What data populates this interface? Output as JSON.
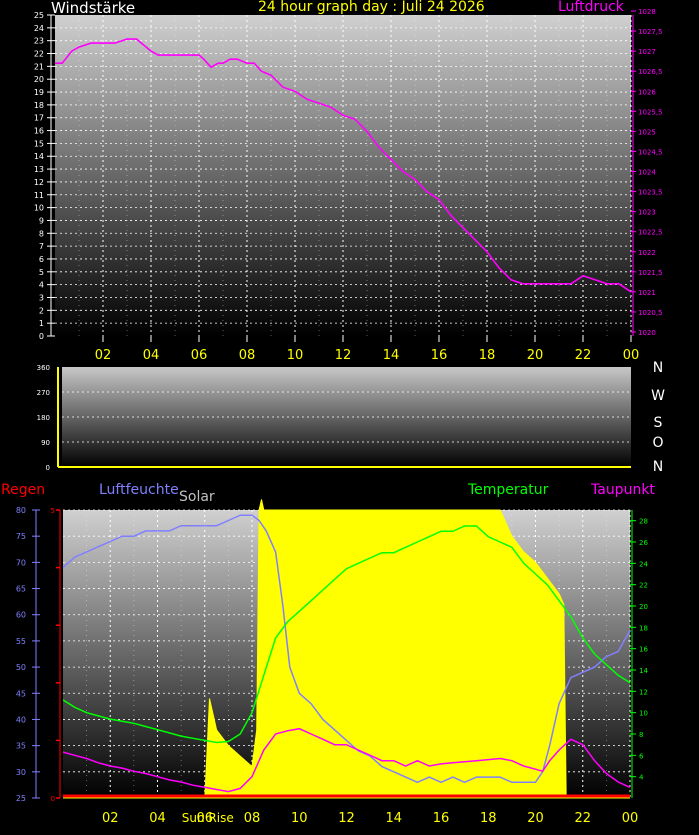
{
  "title": "24 hour graph day : Juli 24 2026",
  "colors": {
    "background": "#000000",
    "wind_label": "#ffffff",
    "pressure": "#ff00ff",
    "humidity": "#8080ff",
    "solar_label": "#c0c0c0",
    "solar_fill": "#ffff00",
    "temperature": "#00ff00",
    "dewpoint": "#ff00ff",
    "rain": "#ff0000",
    "tick_hours": "#ffff00",
    "direction_axis": "#ffff00"
  },
  "chart_data": [
    {
      "type": "line",
      "title": "24 hour graph day : Juli 24 2026",
      "left_axis_label": "Windstärke",
      "right_axis_label": "Luftdruck",
      "left_ylim": [
        0,
        25
      ],
      "left_ticks": [
        "0",
        "1",
        "2",
        "3",
        "4",
        "5",
        "6",
        "7",
        "8",
        "9",
        "10",
        "11",
        "12",
        "13",
        "14",
        "15",
        "16",
        "17",
        "18",
        "19",
        "20",
        "21",
        "22",
        "23",
        "24",
        "25"
      ],
      "right_ylim": [
        1020,
        1028
      ],
      "right_ticks": [
        "1020",
        "1020,5",
        "1021",
        "1021,5",
        "1022",
        "1022,5",
        "1023",
        "1023,5",
        "1024",
        "1024,5",
        "1025",
        "1025,5",
        "1026",
        "1026,5",
        "1027",
        "1027,5",
        "1028"
      ],
      "x_ticks": [
        "02",
        "04",
        "06",
        "08",
        "10",
        "12",
        "14",
        "16",
        "18",
        "20",
        "22",
        "00"
      ],
      "grid": true,
      "series": [
        {
          "name": "Luftdruck",
          "color": "#ff00ff",
          "axis": "right",
          "x": [
            0,
            0.3,
            0.7,
            1.0,
            1.5,
            2.0,
            2.5,
            3.0,
            3.4,
            3.8,
            4.0,
            4.3,
            4.5,
            4.8,
            5.2,
            5.6,
            6.0,
            6.2,
            6.5,
            6.8,
            7.0,
            7.3,
            7.6,
            8.0,
            8.3,
            8.6,
            9.0,
            9.5,
            10.0,
            10.5,
            11.0,
            11.5,
            12.0,
            12.5,
            13.0,
            13.5,
            14.0,
            14.5,
            15.0,
            15.5,
            16.0,
            16.5,
            17.0,
            17.5,
            18.0,
            18.5,
            19.0,
            19.5,
            20.0,
            20.5,
            21.0,
            21.5,
            22.0,
            22.5,
            23.0,
            23.5,
            24.0
          ],
          "y": [
            1026.7,
            1026.7,
            1027.0,
            1027.1,
            1027.2,
            1027.2,
            1027.2,
            1027.3,
            1027.3,
            1027.1,
            1027.0,
            1026.9,
            1026.9,
            1026.9,
            1026.9,
            1026.9,
            1026.9,
            1026.8,
            1026.6,
            1026.7,
            1026.7,
            1026.8,
            1026.8,
            1026.7,
            1026.7,
            1026.5,
            1026.4,
            1026.1,
            1026.0,
            1025.8,
            1025.7,
            1025.6,
            1025.4,
            1025.3,
            1025.0,
            1024.6,
            1024.3,
            1024.0,
            1023.8,
            1023.5,
            1023.3,
            1022.9,
            1022.6,
            1022.3,
            1022.0,
            1021.6,
            1021.3,
            1021.2,
            1021.2,
            1021.2,
            1021.2,
            1021.2,
            1021.4,
            1021.3,
            1021.2,
            1021.2,
            1021.0
          ]
        }
      ]
    },
    {
      "type": "scatter",
      "title": "",
      "ylim": [
        0,
        360
      ],
      "y_ticks": [
        "0",
        "90",
        "180",
        "270",
        "360"
      ],
      "direction_labels": [
        "N",
        "W",
        "S",
        "O",
        "N"
      ],
      "grid": true,
      "series": []
    },
    {
      "type": "area",
      "title": "",
      "legend": [
        "Regen",
        "Luftfeuchte",
        "Solar",
        "Temperatur",
        "Taupunkt"
      ],
      "left_ylim": [
        25,
        80
      ],
      "left_ticks": [
        "25",
        "30",
        "35",
        "40",
        "45",
        "50",
        "55",
        "60",
        "65",
        "70",
        "75",
        "80"
      ],
      "rain_ticks": [
        "0",
        "5"
      ],
      "right_ylim": [
        2,
        29
      ],
      "right_ticks": [
        "4",
        "6",
        "8",
        "10",
        "12",
        "14",
        "16",
        "18",
        "20",
        "22",
        "24",
        "26",
        "28"
      ],
      "x_ticks": [
        "02",
        "04",
        "06",
        "08",
        "10",
        "12",
        "14",
        "16",
        "18",
        "20",
        "22",
        "00"
      ],
      "annotations": [
        "Sun Rise"
      ],
      "sunrise_hour": 6.0,
      "grid": true,
      "series": [
        {
          "name": "Solar",
          "color": "#ffff00",
          "axis": "left",
          "x": [
            0,
            5.9,
            6.0,
            6.2,
            6.5,
            7.0,
            7.5,
            8.0,
            8.2,
            8.3,
            8.4,
            8.5,
            8.6,
            8.8,
            9.0,
            9.5,
            10,
            11,
            12,
            13,
            14,
            15,
            16,
            17,
            18,
            18.5,
            19,
            19.5,
            20,
            20.5,
            21,
            21.2,
            21.3,
            24
          ],
          "y": [
            25,
            25,
            25,
            44,
            38,
            35,
            33,
            31,
            38,
            80,
            82,
            80,
            80,
            80,
            80,
            80,
            80,
            80,
            80,
            80,
            80,
            80,
            80,
            80,
            80,
            80,
            75,
            72,
            70,
            67,
            64,
            62,
            25,
            25
          ]
        },
        {
          "name": "Luftfeuchte",
          "color": "#8080ff",
          "axis": "left",
          "x": [
            0,
            0.5,
            1,
            1.5,
            2,
            2.5,
            3,
            3.5,
            4,
            4.5,
            5,
            5.5,
            6,
            6.5,
            7,
            7.5,
            8,
            8.3,
            8.6,
            9,
            9.3,
            9.6,
            10,
            10.5,
            11,
            11.5,
            12,
            12.5,
            13,
            13.5,
            14,
            14.5,
            15,
            15.5,
            16,
            16.5,
            17,
            17.5,
            18,
            18.5,
            19,
            19.5,
            20,
            20.3,
            20.6,
            21,
            21.5,
            22,
            22.5,
            23,
            23.5,
            24
          ],
          "y": [
            69,
            71,
            72,
            73,
            74,
            75,
            75,
            76,
            76,
            76,
            77,
            77,
            77,
            77,
            78,
            79,
            79,
            78,
            76,
            72,
            62,
            50,
            45,
            43,
            40,
            38,
            36,
            34,
            33,
            31,
            30,
            29,
            28,
            29,
            28,
            29,
            28,
            29,
            29,
            29,
            28,
            28,
            28,
            30,
            35,
            43,
            48,
            49,
            50,
            52,
            53,
            57
          ]
        },
        {
          "name": "Temperatur",
          "color": "#00ff00",
          "axis": "right",
          "x": [
            0,
            0.5,
            1,
            1.5,
            2,
            2.5,
            3,
            3.5,
            4,
            4.5,
            5,
            5.5,
            6,
            6.5,
            7,
            7.5,
            8,
            8.5,
            9,
            9.5,
            10,
            10.5,
            11,
            11.5,
            12,
            12.5,
            13,
            13.5,
            14,
            14.5,
            15,
            15.5,
            16,
            16.5,
            17,
            17.5,
            18,
            18.5,
            19,
            19.5,
            20,
            20.5,
            21,
            21.5,
            22,
            22.5,
            23,
            23.5,
            24
          ],
          "y": [
            11.2,
            10.5,
            10.0,
            9.7,
            9.4,
            9.2,
            9.0,
            8.7,
            8.4,
            8.1,
            7.8,
            7.6,
            7.4,
            7.2,
            7.3,
            8.0,
            10.0,
            13.5,
            17.0,
            18.5,
            19.5,
            20.5,
            21.5,
            22.5,
            23.5,
            24.0,
            24.5,
            25.0,
            25.0,
            25.5,
            26.0,
            26.5,
            27.0,
            27.0,
            27.5,
            27.5,
            26.5,
            26.0,
            25.5,
            24.0,
            23.0,
            22.0,
            20.5,
            19.0,
            17.0,
            15.5,
            14.5,
            13.5,
            12.8
          ]
        },
        {
          "name": "Taupunkt",
          "color": "#ff00ff",
          "axis": "right",
          "x": [
            0,
            0.5,
            1,
            1.5,
            2,
            2.5,
            3,
            3.5,
            4,
            4.5,
            5,
            5.5,
            6,
            6.5,
            7,
            7.5,
            8,
            8.5,
            9,
            9.5,
            10,
            10.5,
            11,
            11.5,
            12,
            12.5,
            13,
            13.5,
            14,
            14.5,
            15,
            15.5,
            16,
            16.5,
            17,
            17.5,
            18,
            18.5,
            19,
            19.5,
            20,
            20.3,
            20.6,
            21,
            21.5,
            22,
            22.5,
            23,
            23.5,
            24
          ],
          "y": [
            6.3,
            6.0,
            5.7,
            5.3,
            5.0,
            4.8,
            4.5,
            4.3,
            4.0,
            3.7,
            3.5,
            3.2,
            3.0,
            2.8,
            2.6,
            2.9,
            4.0,
            6.5,
            8.0,
            8.3,
            8.5,
            8.0,
            7.5,
            7.0,
            7.0,
            6.5,
            6.0,
            5.5,
            5.5,
            5.0,
            5.5,
            5.0,
            5.2,
            5.3,
            5.4,
            5.5,
            5.6,
            5.7,
            5.5,
            5.0,
            4.7,
            4.5,
            5.5,
            6.5,
            7.5,
            7.0,
            5.5,
            4.3,
            3.5,
            3.0
          ]
        },
        {
          "name": "Regen",
          "color": "#ff0000",
          "axis": "rain",
          "x": [
            0,
            24
          ],
          "y": [
            0,
            0
          ]
        }
      ]
    }
  ]
}
